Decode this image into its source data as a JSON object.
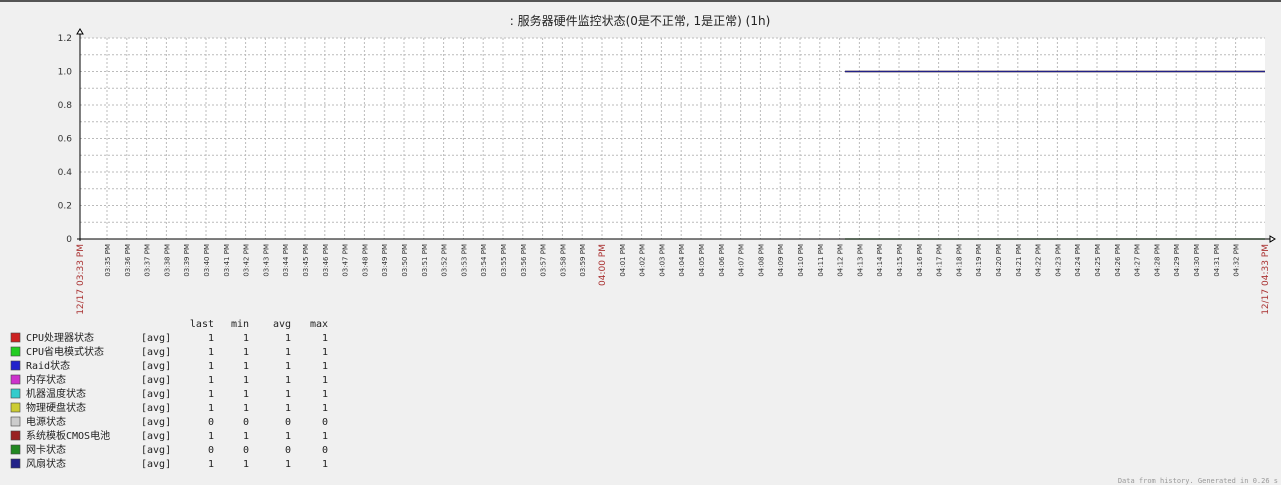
{
  "chart_data": {
    "type": "line",
    "title": ": 服务器硬件监控状态(0是不正常, 1是正常) (1h)",
    "ylim": [
      0,
      1.2
    ],
    "yticks": [
      "0",
      "0.2",
      "0.4",
      "0.6",
      "0.8",
      "1.0",
      "1.2"
    ],
    "ytick_values": [
      0,
      0.2,
      0.4,
      0.6,
      0.8,
      1.0,
      1.2
    ],
    "x_range_minutes": [
      "03:33.64 PM",
      "04:33.5 PM"
    ],
    "x_start_label": "12/17 03:33 PM",
    "x_end_label": "12/17 04:33 PM",
    "x_ticks": [
      "03:35 PM",
      "03:36 PM",
      "03:37 PM",
      "03:38 PM",
      "03:39 PM",
      "03:40 PM",
      "03:41 PM",
      "03:42 PM",
      "03:43 PM",
      "03:44 PM",
      "03:45 PM",
      "03:46 PM",
      "03:47 PM",
      "03:48 PM",
      "03:49 PM",
      "03:50 PM",
      "03:51 PM",
      "03:52 PM",
      "03:53 PM",
      "03:54 PM",
      "03:55 PM",
      "03:56 PM",
      "03:57 PM",
      "03:58 PM",
      "03:59 PM",
      "04:00 PM",
      "04:01 PM",
      "04:02 PM",
      "04:03 PM",
      "04:04 PM",
      "04:05 PM",
      "04:06 PM",
      "04:07 PM",
      "04:08 PM",
      "04:09 PM",
      "04:10 PM",
      "04:11 PM",
      "04:12 PM",
      "04:13 PM",
      "04:14 PM",
      "04:15 PM",
      "04:16 PM",
      "04:17 PM",
      "04:18 PM",
      "04:19 PM",
      "04:20 PM",
      "04:21 PM",
      "04:22 PM",
      "04:23 PM",
      "04:24 PM",
      "04:25 PM",
      "04:26 PM",
      "04:27 PM",
      "04:28 PM",
      "04:29 PM",
      "04:30 PM",
      "04:31 PM",
      "04:32 PM"
    ],
    "highlight_tick": "04:00 PM",
    "data_start_minute_offset": 38.6,
    "legend_headers": [
      "last",
      "min",
      "avg",
      "max"
    ],
    "series": [
      {
        "name": "CPU处理器状态",
        "func": "[avg]",
        "color": "#cc2222",
        "last": "1",
        "min": "1",
        "avg": "1",
        "max": "1",
        "value": 1
      },
      {
        "name": "CPU省电模式状态",
        "func": "[avg]",
        "color": "#22cc22",
        "last": "1",
        "min": "1",
        "avg": "1",
        "max": "1",
        "value": 1
      },
      {
        "name": "Raid状态",
        "func": "[avg]",
        "color": "#2222cc",
        "last": "1",
        "min": "1",
        "avg": "1",
        "max": "1",
        "value": 1
      },
      {
        "name": "内存状态",
        "func": "[avg]",
        "color": "#cc33cc",
        "last": "1",
        "min": "1",
        "avg": "1",
        "max": "1",
        "value": 1
      },
      {
        "name": "机器温度状态",
        "func": "[avg]",
        "color": "#33cccc",
        "last": "1",
        "min": "1",
        "avg": "1",
        "max": "1",
        "value": 1
      },
      {
        "name": "物理硬盘状态",
        "func": "[avg]",
        "color": "#cccc33",
        "last": "1",
        "min": "1",
        "avg": "1",
        "max": "1",
        "value": 1
      },
      {
        "name": "电源状态",
        "func": "[avg]",
        "color": "#cccccc",
        "last": "0",
        "min": "0",
        "avg": "0",
        "max": "0",
        "value": 0
      },
      {
        "name": "系统模板CMOS电池",
        "func": "[avg]",
        "color": "#992222",
        "last": "1",
        "min": "1",
        "avg": "1",
        "max": "1",
        "value": 1
      },
      {
        "name": "网卡状态",
        "func": "[avg]",
        "color": "#228822",
        "last": "0",
        "min": "0",
        "avg": "0",
        "max": "0",
        "value": 0
      },
      {
        "name": "风扇状态",
        "func": "[avg]",
        "color": "#222288",
        "last": "1",
        "min": "1",
        "avg": "1",
        "max": "1",
        "value": 1
      }
    ],
    "footer": "Data from history. Generated in 0.26 s"
  }
}
